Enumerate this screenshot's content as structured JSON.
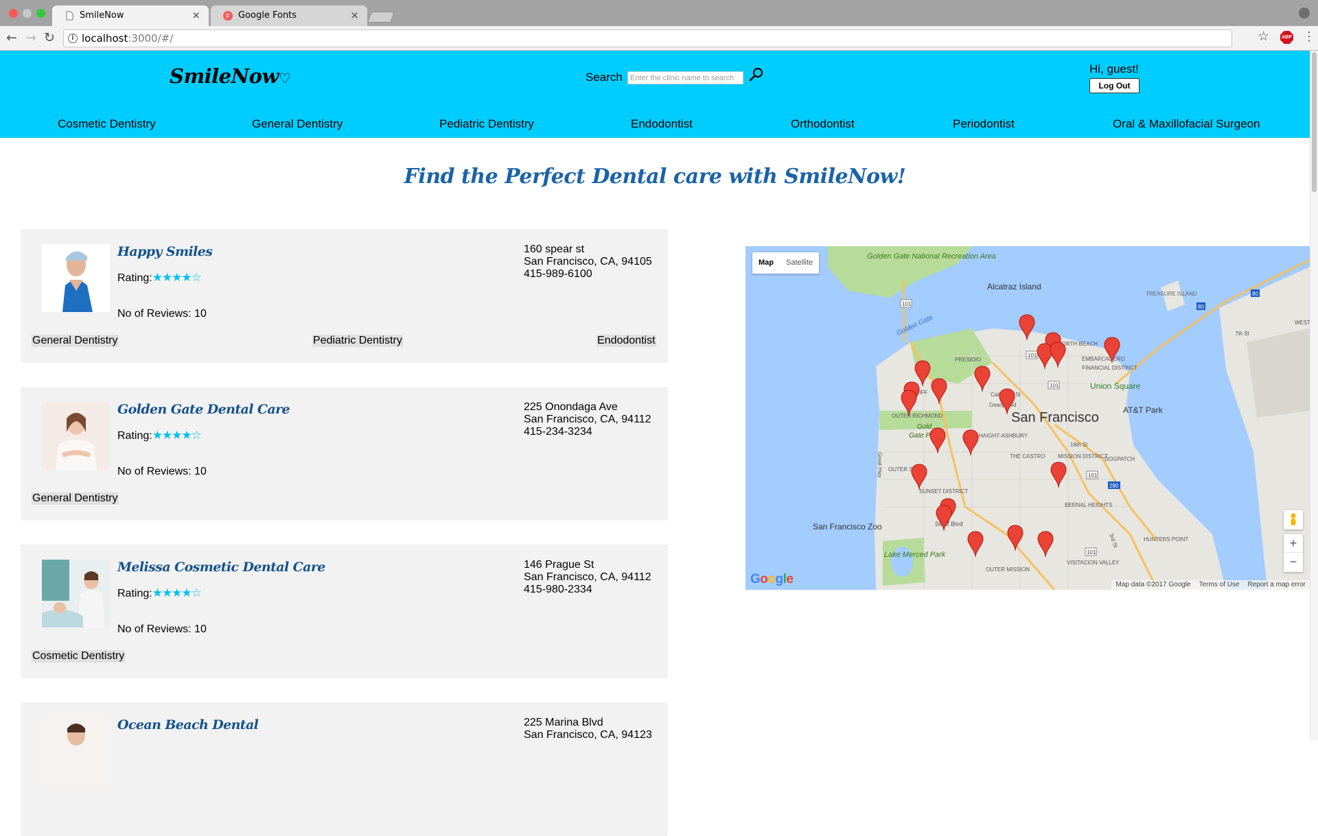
{
  "browser": {
    "tabs": [
      {
        "title": "SmileNow",
        "active": true
      },
      {
        "title": "Google Fonts",
        "active": false
      }
    ],
    "url_host": "localhost",
    "url_path": ":3000/#/"
  },
  "header": {
    "logo": "SmileNow",
    "search_label": "Search",
    "search_placeholder": "Enter the clinic name to search",
    "greeting": "Hi, guest!",
    "logout_label": "Log Out",
    "categories": [
      "Cosmetic Dentistry",
      "General Dentistry",
      "Pediatric Dentistry",
      "Endodontist",
      "Orthodontist",
      "Periodontist",
      "Oral & Maxillofacial Surgeon"
    ]
  },
  "main": {
    "heading": "Find the Perfect Dental care with SmileNow!",
    "clinics": [
      {
        "name": "Happy Smiles",
        "rating_label": "Rating:",
        "rating": 4,
        "reviews": "No of Reviews: 10",
        "address": [
          "160 spear st",
          "San Francisco, CA, 94105",
          "415-989-6100"
        ],
        "tags": [
          "General Dentistry",
          "Pediatric Dentistry",
          "Endodontist"
        ]
      },
      {
        "name": "Golden Gate Dental Care",
        "rating_label": "Rating:",
        "rating": 4,
        "reviews": "No of Reviews: 10",
        "address": [
          "225 Onondaga Ave",
          "San Francisco, CA, 94112",
          "415-234-3234"
        ],
        "tags": [
          "General Dentistry"
        ]
      },
      {
        "name": "Melissa Cosmetic Dental Care",
        "rating_label": "Rating:",
        "rating": 4,
        "reviews": "No of Reviews: 10",
        "address": [
          "146 Prague St",
          "San Francisco, CA, 94112",
          "415-980-2334"
        ],
        "tags": [
          "Cosmetic Dentistry"
        ]
      },
      {
        "name": "Ocean Beach Dental",
        "address": [
          "225 Marina Blvd",
          "San Francisco, CA, 94123"
        ]
      }
    ]
  },
  "map": {
    "type_map": "Map",
    "type_satellite": "Satellite",
    "labels": {
      "golden_gate_nra": "Golden Gate National Recreation Area",
      "alcatraz": "Alcatraz Island",
      "treasure_island": "TREASURE ISLAND",
      "golden_gate": "Golden Gate",
      "presidio": "PRESIDIO",
      "north_beach": "NORTH BEACH",
      "embarcadero": "EMBARCADERO",
      "financial_district": "FINANCIAL DISTRICT",
      "union_square": "Union Square",
      "san_francisco": "San Francisco",
      "att_park": "AT&T Park",
      "haight_ashbury": "HAIGHT-ASHBURY",
      "the_castro": "THE CASTRO",
      "mission_district": "MISSION DISTRICT",
      "dogpatch": "DOGPATCH",
      "outer_richmond": "OUTER RICHMOND",
      "sunset_district": "SUNSET DISTRICT",
      "bernal_heights": "BERNAL HEIGHTS",
      "sf_zoo": "San Francisco Zoo",
      "lake_merced": "Lake Merced Park",
      "outer_mission": "OUTER MISSION",
      "visitacion_valley": "VISITACION VALLEY",
      "hunters_point": "HUNTERS POINT",
      "sloat_blvd": "Sloat Blvd",
      "geary_blvd": "Geary Blvd",
      "california_st": "California St",
      "seventh_st": "7th St",
      "west": "WEST",
      "outer_sunset": "OUTER S",
      "gold_park": "Gold",
      "gate_park": "Gate P",
      "cliff": "CLIFF",
      "great_hwy": "Great Hwy",
      "sixteenth_st": "16th St",
      "third_st": "3rd St",
      "route_101": "101",
      "route_80": "80",
      "route_280": "280"
    },
    "google": "Google",
    "footer": [
      "Map data ©2017 Google",
      "Terms of Use",
      "Report a map error"
    ],
    "colors": {
      "water": "#a3ccff",
      "land": "#e8e6e0",
      "park": "#b7dc9a",
      "marker": "#ea4335"
    }
  }
}
